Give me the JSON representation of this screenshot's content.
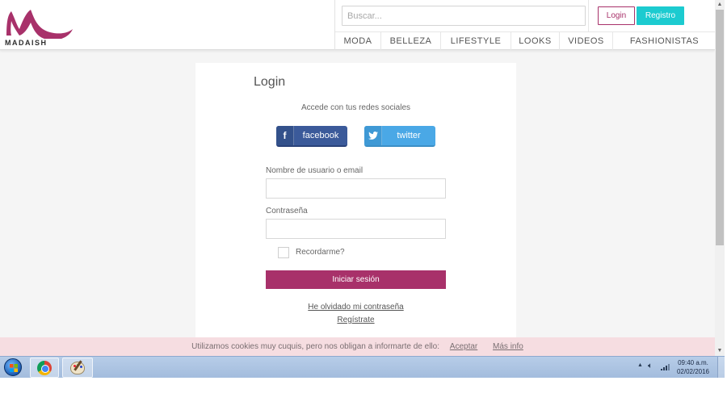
{
  "brand": {
    "name": "MADAISH",
    "accent": "#a8316a",
    "teal": "#1ccbd0"
  },
  "header": {
    "search_placeholder": "Buscar...",
    "login_label": "Login",
    "register_label": "Registro",
    "nav": [
      "MODA",
      "BELLEZA",
      "LIFESTYLE",
      "LOOKS",
      "VIDEOS",
      "FASHIONISTAS"
    ]
  },
  "login": {
    "title": "Login",
    "social_text": "Accede con tus redes sociales",
    "facebook_label": "facebook",
    "facebook_icon": "f",
    "twitter_label": "twitter",
    "username_label": "Nombre de usuario o email",
    "password_label": "Contraseña",
    "remember_label": "Recordarme?",
    "submit_label": "Iniciar sesión",
    "forgot_label": "He olvidado mi contraseña",
    "signup_label": "Regístrate"
  },
  "cookie": {
    "text": "Utilizamos cookies muy cuquis, pero nos obligan a informarte de ello:",
    "accept_label": "Aceptar",
    "more_label": "Más info"
  },
  "taskbar": {
    "time": "09:40 a.m.",
    "date": "02/02/2016",
    "apps": [
      "chrome-icon",
      "paint-icon"
    ]
  }
}
